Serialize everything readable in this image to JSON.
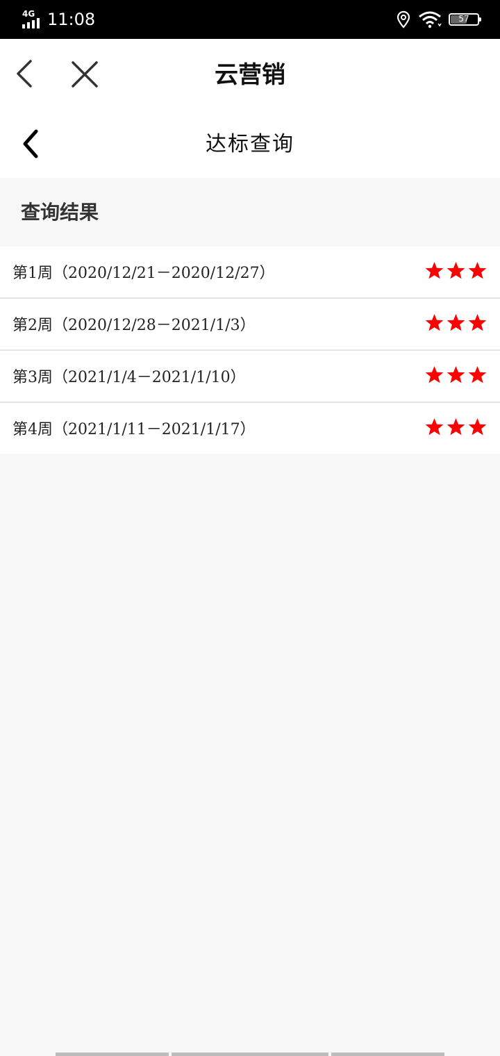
{
  "status_bar": {
    "network": "4G",
    "time": "11:08",
    "battery_level": "57"
  },
  "header": {
    "app_title": "云营销"
  },
  "page": {
    "title": "达标查询",
    "section_title": "查询结果"
  },
  "results": [
    {
      "label": "第1周（2020/12/21－2020/12/27）",
      "stars": 3
    },
    {
      "label": "第2周（2020/12/28－2021/1/3）",
      "stars": 3
    },
    {
      "label": "第3周（2021/1/4－2021/1/10）",
      "stars": 3
    },
    {
      "label": "第4周（2021/1/11－2021/1/17）",
      "stars": 3
    }
  ],
  "colors": {
    "star": "#ff0000",
    "icon": "#333333",
    "status_bar_bg": "#000000",
    "page_bg": "#f8f8f8"
  },
  "icons": {
    "header_back": "chevron-left-icon",
    "header_close": "close-icon",
    "page_back": "chevron-left-icon",
    "rating": "star-icon",
    "location": "location-icon",
    "wifi": "wifi-icon",
    "battery": "battery-icon",
    "signal": "signal-icon"
  }
}
